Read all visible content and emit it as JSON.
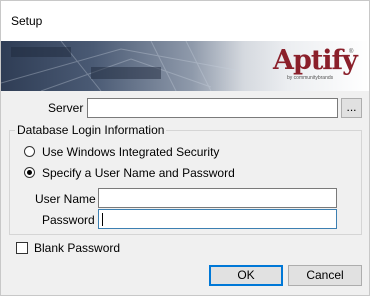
{
  "window": {
    "title": "Setup"
  },
  "banner": {
    "logo_text": "Aptify",
    "logo_registered": "®",
    "logo_tagline": "by communitybrands"
  },
  "server": {
    "label": "Server",
    "value": "",
    "browse_label": "..."
  },
  "login_group": {
    "title": "Database Login Information",
    "options": [
      {
        "label": "Use Windows Integrated Security",
        "selected": false
      },
      {
        "label": "Specify a User Name and Password",
        "selected": true
      }
    ],
    "username": {
      "label": "User Name",
      "value": ""
    },
    "password": {
      "label": "Password",
      "value": ""
    }
  },
  "blank_password": {
    "label": "Blank Password",
    "checked": false
  },
  "buttons": {
    "ok": "OK",
    "cancel": "Cancel"
  },
  "colors": {
    "logo_red": "#8a1f2a",
    "focus_border": "#0078d7"
  }
}
